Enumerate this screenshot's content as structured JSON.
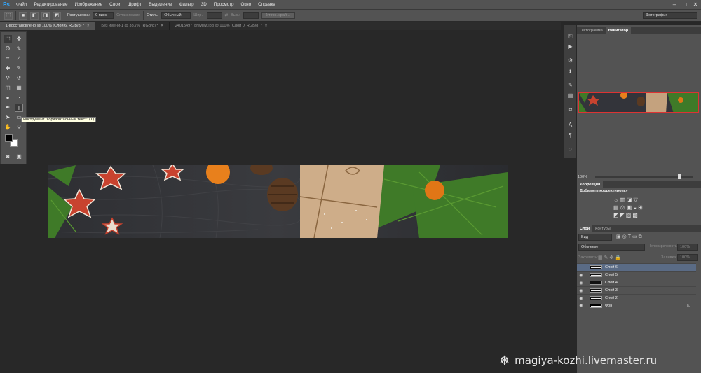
{
  "app": {
    "logo": "Ps"
  },
  "menu": [
    "Файл",
    "Редактирование",
    "Изображение",
    "Слои",
    "Шрифт",
    "Выделение",
    "Фильтр",
    "3D",
    "Просмотр",
    "Окно",
    "Справка"
  ],
  "window_controls": {
    "minimize": "–",
    "restore": "□",
    "close": "✕"
  },
  "options": {
    "feather_label": "Растушевка:",
    "feather_value": "0 пикс.",
    "antialias_label": "Сглаживание",
    "style_label": "Стиль:",
    "style_value": "Обычный",
    "width_label": "Шир.:",
    "height_label": "Выс.:",
    "refine_label": "Уточн. край...",
    "workspace": "Фотография"
  },
  "tabs": [
    {
      "label": "1-восстановлено @ 100% (Слой 6, RGB/8) *",
      "close": "×"
    },
    {
      "label": "Без имени-1 @ 38,7% (RGB/8) *",
      "close": "×"
    },
    {
      "label": "24015497_preview.jpg @ 100% (Слой 0, RGB/8) *",
      "close": "×"
    }
  ],
  "tooltip": "Инструмент \"Горизонтальный текст\" (T)",
  "tools": {
    "marquee": "⬚",
    "move": "✥",
    "lasso": "ʘ",
    "wand": "✎",
    "crop": "⌗",
    "eyedropper": "⁄",
    "heal": "✚",
    "brush": "✎",
    "stamp": "⚲",
    "history": "↺",
    "eraser": "◫",
    "gradient": "▦",
    "blur": "●",
    "dodge": "◔",
    "pen": "✒",
    "type": "T",
    "path_select": "➤",
    "shape": "▭",
    "hand": "✋",
    "zoom": "⚲",
    "mask": "◙",
    "screen": "▣"
  },
  "panels": {
    "top_tabs": [
      "Гистограмма",
      "Навигатор"
    ],
    "zoom": "100%",
    "corrections_tab": "Коррекция",
    "corrections_title": "Добавить корректировку",
    "layers_tabs": [
      "Слои",
      "Контуры"
    ],
    "kind_filter": "Вид",
    "blend_mode": "Обычные",
    "opacity_label": "Непрозрачность:",
    "opacity_value": "100%",
    "lock_label": "Закрепить:",
    "fill_label": "Заливка:",
    "fill_value": "100%",
    "layers": [
      {
        "name": "Слой 6",
        "visible": false,
        "active": true
      },
      {
        "name": "Слой 5",
        "visible": true,
        "active": false
      },
      {
        "name": "Слой 4",
        "visible": true,
        "active": false
      },
      {
        "name": "Слой 3",
        "visible": true,
        "active": false
      },
      {
        "name": "Слой 2",
        "visible": true,
        "active": false
      },
      {
        "name": "Фон",
        "visible": true,
        "active": false,
        "locked": true
      }
    ]
  },
  "watermark": "magiya-kozhi.livemaster.ru"
}
